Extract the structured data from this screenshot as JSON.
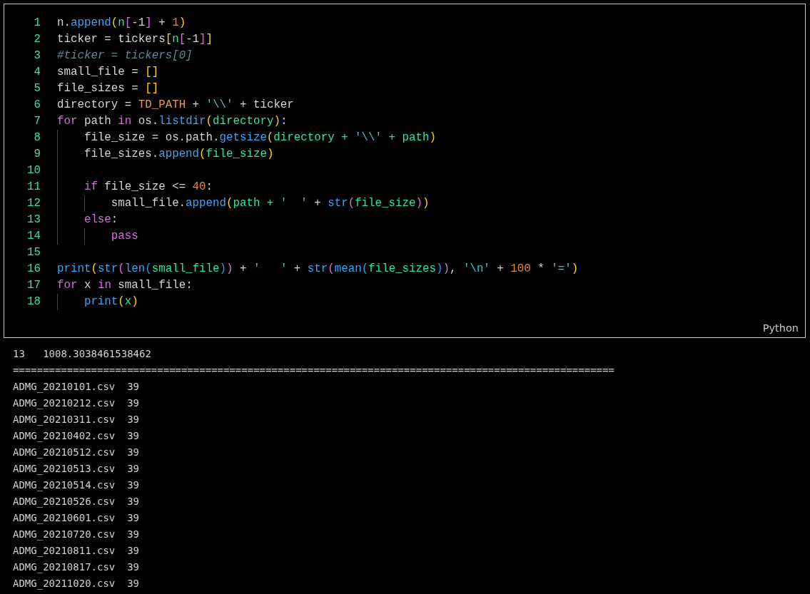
{
  "code_block": {
    "language": "Python",
    "lines": [
      {
        "number": "1",
        "tokens": [
          {
            "text": "n.",
            "kind": "plain"
          },
          {
            "text": "append",
            "kind": "function"
          },
          {
            "text": "(",
            "kind": "bracket1"
          },
          {
            "text": "n",
            "kind": "variable"
          },
          {
            "text": "[",
            "kind": "bracket2"
          },
          {
            "text": "-1",
            "kind": "plain"
          },
          {
            "text": "]",
            "kind": "bracket2"
          },
          {
            "text": " + ",
            "kind": "plain"
          },
          {
            "text": "1",
            "kind": "number"
          },
          {
            "text": ")",
            "kind": "bracket1"
          }
        ]
      },
      {
        "number": "2",
        "tokens": [
          {
            "text": "ticker = tickers",
            "kind": "plain"
          },
          {
            "text": "[",
            "kind": "bracket1"
          },
          {
            "text": "n",
            "kind": "variable"
          },
          {
            "text": "[",
            "kind": "bracket2"
          },
          {
            "text": "-1",
            "kind": "plain"
          },
          {
            "text": "]",
            "kind": "bracket2"
          },
          {
            "text": "]",
            "kind": "bracket1"
          }
        ]
      },
      {
        "number": "3",
        "tokens": [
          {
            "text": "#ticker = tickers[0]",
            "kind": "comment"
          }
        ]
      },
      {
        "number": "4",
        "tokens": [
          {
            "text": "small_file = ",
            "kind": "plain"
          },
          {
            "text": "[]",
            "kind": "bracket1"
          }
        ]
      },
      {
        "number": "5",
        "tokens": [
          {
            "text": "file_sizes = ",
            "kind": "plain"
          },
          {
            "text": "[]",
            "kind": "bracket1"
          }
        ]
      },
      {
        "number": "6",
        "tokens": [
          {
            "text": "directory = ",
            "kind": "plain"
          },
          {
            "text": "TD_PATH",
            "kind": "constant"
          },
          {
            "text": " + ",
            "kind": "plain"
          },
          {
            "text": "'\\\\'",
            "kind": "string"
          },
          {
            "text": " + ticker",
            "kind": "plain"
          }
        ]
      },
      {
        "number": "7",
        "tokens": [
          {
            "text": "for",
            "kind": "keyword"
          },
          {
            "text": " path ",
            "kind": "plain"
          },
          {
            "text": "in",
            "kind": "keyword"
          },
          {
            "text": " os.",
            "kind": "plain"
          },
          {
            "text": "listdir",
            "kind": "function"
          },
          {
            "text": "(",
            "kind": "bracket1"
          },
          {
            "text": "directory",
            "kind": "variable"
          },
          {
            "text": ")",
            "kind": "bracket1"
          },
          {
            "text": ":",
            "kind": "plain"
          }
        ],
        "children": [
          {
            "number": "8",
            "tokens": [
              {
                "text": "file_size = os.path.",
                "kind": "plain"
              },
              {
                "text": "getsize",
                "kind": "function"
              },
              {
                "text": "(",
                "kind": "bracket1"
              },
              {
                "text": "directory + ",
                "kind": "variable"
              },
              {
                "text": "'\\\\'",
                "kind": "string"
              },
              {
                "text": " + path",
                "kind": "variable"
              },
              {
                "text": ")",
                "kind": "bracket1"
              }
            ]
          },
          {
            "number": "9",
            "tokens": [
              {
                "text": "file_sizes.",
                "kind": "plain"
              },
              {
                "text": "append",
                "kind": "function"
              },
              {
                "text": "(",
                "kind": "bracket1"
              },
              {
                "text": "file_size",
                "kind": "variable"
              },
              {
                "text": ")",
                "kind": "bracket1"
              }
            ]
          },
          {
            "number": "10"
          },
          {
            "number": "11",
            "tokens": [
              {
                "text": "if",
                "kind": "keyword"
              },
              {
                "text": " file_size <= ",
                "kind": "plain"
              },
              {
                "text": "40",
                "kind": "number"
              },
              {
                "text": ":",
                "kind": "plain"
              }
            ],
            "children": [
              {
                "number": "12",
                "tokens": [
                  {
                    "text": "small_file.",
                    "kind": "plain"
                  },
                  {
                    "text": "append",
                    "kind": "function"
                  },
                  {
                    "text": "(",
                    "kind": "bracket1"
                  },
                  {
                    "text": "path + ",
                    "kind": "variable"
                  },
                  {
                    "text": "'  '",
                    "kind": "string"
                  },
                  {
                    "text": " + ",
                    "kind": "plain"
                  },
                  {
                    "text": "str",
                    "kind": "function"
                  },
                  {
                    "text": "(",
                    "kind": "bracket2"
                  },
                  {
                    "text": "file_size",
                    "kind": "variable"
                  },
                  {
                    "text": ")",
                    "kind": "bracket2"
                  },
                  {
                    "text": ")",
                    "kind": "bracket1"
                  }
                ]
              }
            ]
          },
          {
            "number": "13",
            "tokens": [
              {
                "text": "else",
                "kind": "keyword"
              },
              {
                "text": ":",
                "kind": "plain"
              }
            ],
            "children": [
              {
                "number": "14",
                "tokens": [
                  {
                    "text": "pass",
                    "kind": "keyword"
                  }
                ]
              }
            ]
          }
        ]
      },
      {
        "number": "15"
      },
      {
        "number": "16",
        "tokens": [
          {
            "text": "print",
            "kind": "function"
          },
          {
            "text": "(",
            "kind": "bracket1"
          },
          {
            "text": "str",
            "kind": "function"
          },
          {
            "text": "(",
            "kind": "bracket2"
          },
          {
            "text": "len",
            "kind": "function"
          },
          {
            "text": "(",
            "kind": "bracket3"
          },
          {
            "text": "small_file",
            "kind": "variable"
          },
          {
            "text": ")",
            "kind": "bracket3"
          },
          {
            "text": ")",
            "kind": "bracket2"
          },
          {
            "text": " + ",
            "kind": "plain"
          },
          {
            "text": "'   '",
            "kind": "string"
          },
          {
            "text": " + ",
            "kind": "plain"
          },
          {
            "text": "str",
            "kind": "function"
          },
          {
            "text": "(",
            "kind": "bracket2"
          },
          {
            "text": "mean",
            "kind": "function"
          },
          {
            "text": "(",
            "kind": "bracket3"
          },
          {
            "text": "file_sizes",
            "kind": "variable"
          },
          {
            "text": ")",
            "kind": "bracket3"
          },
          {
            "text": ")",
            "kind": "bracket2"
          },
          {
            "text": ", ",
            "kind": "plain"
          },
          {
            "text": "'\\n'",
            "kind": "string"
          },
          {
            "text": " + ",
            "kind": "plain"
          },
          {
            "text": "100",
            "kind": "number"
          },
          {
            "text": " * ",
            "kind": "plain"
          },
          {
            "text": "'='",
            "kind": "string"
          },
          {
            "text": ")",
            "kind": "bracket1"
          }
        ]
      },
      {
        "number": "17",
        "tokens": [
          {
            "text": "for",
            "kind": "keyword"
          },
          {
            "text": " x ",
            "kind": "plain"
          },
          {
            "text": "in",
            "kind": "keyword"
          },
          {
            "text": " small_file:",
            "kind": "plain"
          }
        ],
        "children": [
          {
            "number": "18",
            "tokens": [
              {
                "text": "print",
                "kind": "function"
              },
              {
                "text": "(",
                "kind": "bracket1"
              },
              {
                "text": "x",
                "kind": "variable"
              },
              {
                "text": ")",
                "kind": "bracket1"
              }
            ]
          }
        ]
      }
    ]
  },
  "output": [
    "13   1008.3038461538462",
    "====================================================================================================",
    "ADMG_20210101.csv  39",
    "ADMG_20210212.csv  39",
    "ADMG_20210311.csv  39",
    "ADMG_20210402.csv  39",
    "ADMG_20210512.csv  39",
    "ADMG_20210513.csv  39",
    "ADMG_20210514.csv  39",
    "ADMG_20210526.csv  39",
    "ADMG_20210601.csv  39",
    "ADMG_20210720.csv  39",
    "ADMG_20210811.csv  39",
    "ADMG_20210817.csv  39",
    "ADMG_20211020.csv  39"
  ]
}
